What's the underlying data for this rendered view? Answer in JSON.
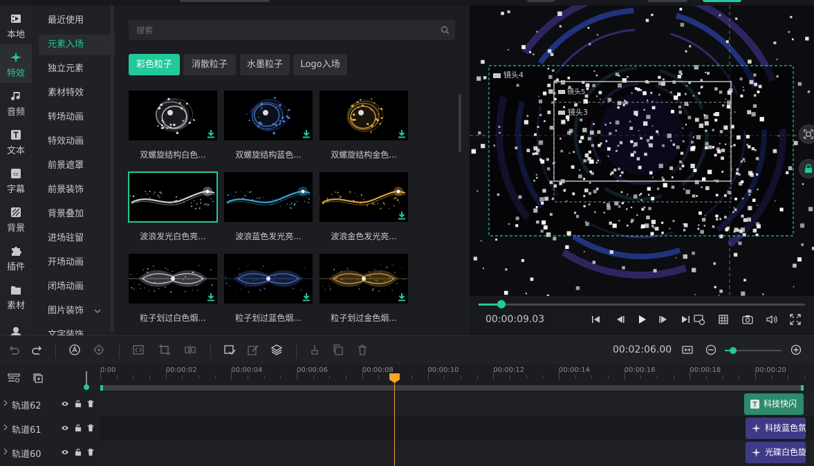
{
  "sidebar": {
    "items": [
      {
        "label": "本地",
        "icon": "film-icon",
        "active": false
      },
      {
        "label": "特效",
        "icon": "sparkle-icon",
        "active": true
      },
      {
        "label": "音频",
        "icon": "music-note-icon",
        "active": false
      },
      {
        "label": "文本",
        "icon": "text-icon",
        "active": false
      },
      {
        "label": "字幕",
        "icon": "caption-icon",
        "active": false
      },
      {
        "label": "背景",
        "icon": "background-icon",
        "active": false
      },
      {
        "label": "插件",
        "icon": "puzzle-icon",
        "active": false
      },
      {
        "label": "素材",
        "icon": "folder-icon",
        "active": false
      }
    ]
  },
  "submenu": {
    "items": [
      "最近使用",
      "元素入场",
      "独立元素",
      "素材特效",
      "转场动画",
      "特效动画",
      "前景遮罩",
      "前景装饰",
      "背景叠加",
      "进场驻留",
      "开场动画",
      "闭场动画",
      "图片装饰",
      "文字装饰"
    ],
    "active_index": 1
  },
  "search": {
    "placeholder": "搜索"
  },
  "categories": [
    {
      "label": "彩色粒子",
      "active": true
    },
    {
      "label": "消散粒子",
      "active": false
    },
    {
      "label": "水墨粒子",
      "active": false
    },
    {
      "label": "Logo入场",
      "active": false
    }
  ],
  "effects": [
    {
      "caption": "双螺旋结构白色...",
      "color": "#d9dde6",
      "style": "spiral",
      "selected": false,
      "download": true
    },
    {
      "caption": "双螺旋结构蓝色...",
      "color": "#4f7fe0",
      "style": "spiral",
      "selected": false,
      "download": true
    },
    {
      "caption": "双螺旋结构金色...",
      "color": "#e0a84a",
      "style": "spiral",
      "selected": false,
      "download": true
    },
    {
      "caption": "波浪发光白色亮...",
      "color": "#e6e8ee",
      "style": "wave",
      "selected": true,
      "download": false
    },
    {
      "caption": "波浪蓝色发光亮...",
      "color": "#3fb6e8",
      "style": "wave",
      "selected": false,
      "download": false
    },
    {
      "caption": "波浪金色发光亮...",
      "color": "#f0b040",
      "style": "wave",
      "selected": false,
      "download": true
    },
    {
      "caption": "粒子划过白色烟...",
      "color": "#d8dbe2",
      "style": "smoke",
      "selected": false,
      "download": true
    },
    {
      "caption": "粒子划过蓝色烟...",
      "color": "#5577e0",
      "style": "smoke",
      "selected": false,
      "download": true
    },
    {
      "caption": "粒子划过金色烟...",
      "color": "#e2b04c",
      "style": "smoke",
      "selected": false,
      "download": true
    }
  ],
  "preview": {
    "camera_labels": [
      "镜头4",
      "镜头5",
      "镜头3"
    ],
    "timecode": "00:00:09.03",
    "progress": 0.07
  },
  "toolbar": {
    "duration": "00:02:06.00",
    "zoom_level": 0.15
  },
  "ruler": {
    "labels": [
      "0:00",
      "00:00:02",
      "00:00:04",
      "00:00:06",
      "00:00:08",
      "00:00:10",
      "00:00:12",
      "00:00:14",
      "00:00:16",
      "00:00:18",
      "00:00:20",
      "00:0"
    ]
  },
  "tracks": [
    {
      "name": "轨道62",
      "clip": {
        "label": "科技快闪",
        "kind": "text",
        "color": "#2d8a6c"
      }
    },
    {
      "name": "轨道61",
      "clip": {
        "label": "科技蓝色氛",
        "kind": "effect",
        "color": "#3f3a86"
      }
    },
    {
      "name": "轨道60",
      "clip": {
        "label": "光碟白色旋",
        "kind": "effect",
        "color": "#3f3a86"
      }
    }
  ],
  "accent_color": "#22c99a",
  "playhead_color": "#f5a623"
}
